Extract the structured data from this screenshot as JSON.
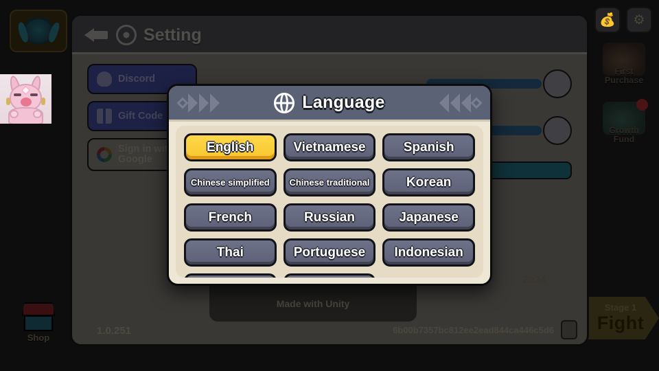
{
  "game_hud": {
    "rank_badge_name": "rank-emblem",
    "character_portrait_name": "character-portrait",
    "shop_label": "Shop",
    "money_icon": "money-bag-icon",
    "settings_icon": "gear-icon",
    "first_purchase_label": "First\nPurchase",
    "first_purchase_line1": "First",
    "first_purchase_line2": "Purchase",
    "growth_fund_line1": "Growth",
    "growth_fund_line2": "Fund",
    "fight_stage": "Stage 1",
    "fight_label": "Fight"
  },
  "setting_panel": {
    "title": "Setting",
    "back_icon": "back-arrow-icon",
    "gear_icon": "gear-icon",
    "accounts": [
      {
        "label": "Discord",
        "icon": "discord-icon"
      },
      {
        "label": "Gift Code",
        "icon": "gift-icon"
      },
      {
        "label": "Sign in with Google",
        "icon": "google-icon"
      }
    ],
    "sliders": [
      {
        "name": "bgm-slider"
      },
      {
        "name": "sfx-slider"
      }
    ],
    "unity_mark": "Unity",
    "made_with_unity": "Made with Unity",
    "year": "2024",
    "version": "1.0.251",
    "build_hash": "6b00b7357bc812ee2ead844ca446c5d6",
    "copy_icon": "copy-icon"
  },
  "language_modal": {
    "title": "Language",
    "globe_icon": "globe-icon",
    "selected": "English",
    "languages": [
      {
        "label": "English",
        "selected": true,
        "small": false
      },
      {
        "label": "Vietnamese",
        "selected": false,
        "small": false
      },
      {
        "label": "Spanish",
        "selected": false,
        "small": false
      },
      {
        "label": "Chinese simplified",
        "selected": false,
        "small": true
      },
      {
        "label": "Chinese traditional",
        "selected": false,
        "small": true
      },
      {
        "label": "Korean",
        "selected": false,
        "small": false
      },
      {
        "label": "French",
        "selected": false,
        "small": false
      },
      {
        "label": "Russian",
        "selected": false,
        "small": false
      },
      {
        "label": "Japanese",
        "selected": false,
        "small": false
      },
      {
        "label": "Thai",
        "selected": false,
        "small": false
      },
      {
        "label": "Portuguese",
        "selected": false,
        "small": false
      },
      {
        "label": "Indonesian",
        "selected": false,
        "small": false
      },
      {
        "label": "",
        "selected": false,
        "small": false
      },
      {
        "label": "",
        "selected": false,
        "small": false
      }
    ]
  },
  "colors": {
    "selected_button": "#ffd84a",
    "selected_button_shadow": "#e09a18",
    "button": "#6e7288",
    "modal_header": "#5b6275",
    "modal_panel": "#e6dcc6",
    "modal_frame": "#efe7d6",
    "panel_bg": "#3a3835",
    "panel_header": "#222224"
  }
}
